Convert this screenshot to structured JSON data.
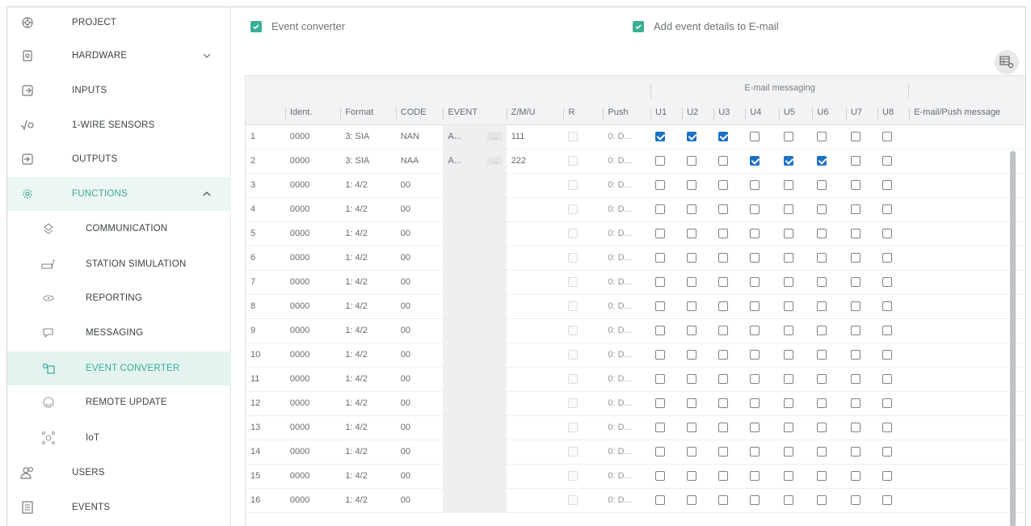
{
  "sidebar": {
    "items": [
      {
        "label": "PROJECT",
        "icon": "project-icon"
      },
      {
        "label": "HARDWARE",
        "icon": "hardware-icon"
      },
      {
        "label": "INPUTS",
        "icon": "inputs-icon"
      },
      {
        "label": "1-WIRE SENSORS",
        "icon": "sensor-icon"
      },
      {
        "label": "OUTPUTS",
        "icon": "outputs-icon"
      },
      {
        "label": "FUNCTIONS",
        "icon": "functions-icon"
      },
      {
        "label": "COMMUNICATION",
        "icon": "communication-icon"
      },
      {
        "label": "STATION SIMULATION",
        "icon": "station-icon"
      },
      {
        "label": "REPORTING",
        "icon": "reporting-icon"
      },
      {
        "label": "MESSAGING",
        "icon": "messaging-icon"
      },
      {
        "label": "EVENT CONVERTER",
        "icon": "event-converter-icon"
      },
      {
        "label": "REMOTE UPDATE",
        "icon": "remote-update-icon"
      },
      {
        "label": "IoT",
        "icon": "iot-icon"
      },
      {
        "label": "USERS",
        "icon": "users-icon"
      },
      {
        "label": "EVENTS",
        "icon": "events-icon"
      }
    ]
  },
  "main": {
    "event_converter_label": "Event converter",
    "add_details_label": "Add event details to E-mail",
    "group_header": "E-mail messaging",
    "columns": [
      "Ident.",
      "Format",
      "CODE",
      "EVENT",
      "Z/M/U",
      "R",
      "Push",
      "U1",
      "U2",
      "U3",
      "U4",
      "U5",
      "U6",
      "U7",
      "U8",
      "E-mail/Push message"
    ],
    "rows": [
      {
        "no": "1",
        "ident": "0000",
        "format": "3: SIA",
        "code": "NAN",
        "event": "A...",
        "zmu": "111",
        "push": "0: D...",
        "u": [
          1,
          1,
          1,
          0,
          0,
          0,
          0,
          0
        ]
      },
      {
        "no": "2",
        "ident": "0000",
        "format": "3: SIA",
        "code": "NAA",
        "event": "A...",
        "zmu": "222",
        "push": "0: D...",
        "u": [
          0,
          0,
          0,
          1,
          1,
          1,
          0,
          0
        ]
      },
      {
        "no": "3",
        "ident": "0000",
        "format": "1: 4/2",
        "code": "00",
        "event": "",
        "zmu": "",
        "push": "0: D...",
        "u": [
          0,
          0,
          0,
          0,
          0,
          0,
          0,
          0
        ]
      },
      {
        "no": "4",
        "ident": "0000",
        "format": "1: 4/2",
        "code": "00",
        "event": "",
        "zmu": "",
        "push": "0: D...",
        "u": [
          0,
          0,
          0,
          0,
          0,
          0,
          0,
          0
        ]
      },
      {
        "no": "5",
        "ident": "0000",
        "format": "1: 4/2",
        "code": "00",
        "event": "",
        "zmu": "",
        "push": "0: D...",
        "u": [
          0,
          0,
          0,
          0,
          0,
          0,
          0,
          0
        ]
      },
      {
        "no": "6",
        "ident": "0000",
        "format": "1: 4/2",
        "code": "00",
        "event": "",
        "zmu": "",
        "push": "0: D...",
        "u": [
          0,
          0,
          0,
          0,
          0,
          0,
          0,
          0
        ]
      },
      {
        "no": "7",
        "ident": "0000",
        "format": "1: 4/2",
        "code": "00",
        "event": "",
        "zmu": "",
        "push": "0: D...",
        "u": [
          0,
          0,
          0,
          0,
          0,
          0,
          0,
          0
        ]
      },
      {
        "no": "8",
        "ident": "0000",
        "format": "1: 4/2",
        "code": "00",
        "event": "",
        "zmu": "",
        "push": "0: D...",
        "u": [
          0,
          0,
          0,
          0,
          0,
          0,
          0,
          0
        ]
      },
      {
        "no": "9",
        "ident": "0000",
        "format": "1: 4/2",
        "code": "00",
        "event": "",
        "zmu": "",
        "push": "0: D...",
        "u": [
          0,
          0,
          0,
          0,
          0,
          0,
          0,
          0
        ]
      },
      {
        "no": "10",
        "ident": "0000",
        "format": "1: 4/2",
        "code": "00",
        "event": "",
        "zmu": "",
        "push": "0: D...",
        "u": [
          0,
          0,
          0,
          0,
          0,
          0,
          0,
          0
        ]
      },
      {
        "no": "11",
        "ident": "0000",
        "format": "1: 4/2",
        "code": "00",
        "event": "",
        "zmu": "",
        "push": "0: D...",
        "u": [
          0,
          0,
          0,
          0,
          0,
          0,
          0,
          0
        ]
      },
      {
        "no": "12",
        "ident": "0000",
        "format": "1: 4/2",
        "code": "00",
        "event": "",
        "zmu": "",
        "push": "0: D...",
        "u": [
          0,
          0,
          0,
          0,
          0,
          0,
          0,
          0
        ]
      },
      {
        "no": "13",
        "ident": "0000",
        "format": "1: 4/2",
        "code": "00",
        "event": "",
        "zmu": "",
        "push": "0: D...",
        "u": [
          0,
          0,
          0,
          0,
          0,
          0,
          0,
          0
        ]
      },
      {
        "no": "14",
        "ident": "0000",
        "format": "1: 4/2",
        "code": "00",
        "event": "",
        "zmu": "",
        "push": "0: D...",
        "u": [
          0,
          0,
          0,
          0,
          0,
          0,
          0,
          0
        ]
      },
      {
        "no": "15",
        "ident": "0000",
        "format": "1: 4/2",
        "code": "00",
        "event": "",
        "zmu": "",
        "push": "0: D...",
        "u": [
          0,
          0,
          0,
          0,
          0,
          0,
          0,
          0
        ]
      },
      {
        "no": "16",
        "ident": "0000",
        "format": "1: 4/2",
        "code": "00",
        "event": "",
        "zmu": "",
        "push": "0: D...",
        "u": [
          0,
          0,
          0,
          0,
          0,
          0,
          0,
          0
        ]
      }
    ]
  },
  "colors": {
    "accent": "#3aa896",
    "check_blue": "#1d71c7",
    "check_green": "#3aaf96"
  }
}
